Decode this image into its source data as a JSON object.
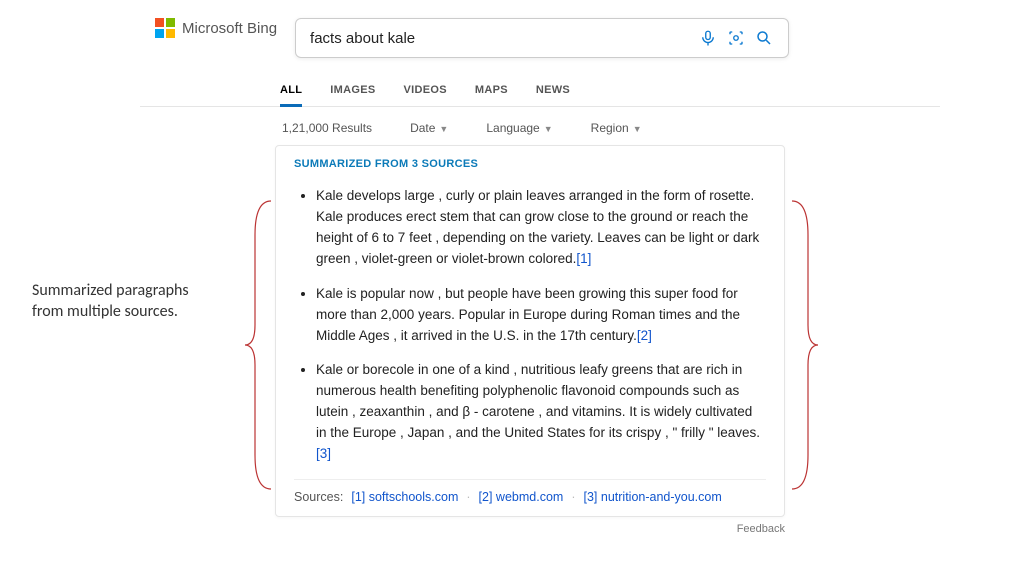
{
  "brand": "Microsoft Bing",
  "search": {
    "query": "facts about kale"
  },
  "tabs": [
    "ALL",
    "IMAGES",
    "VIDEOS",
    "MAPS",
    "NEWS"
  ],
  "results_count": "1,21,000 Results",
  "filters": {
    "date": "Date",
    "language": "Language",
    "region": "Region"
  },
  "summary": {
    "label": "SUMMARIZED FROM 3 SOURCES",
    "items": [
      {
        "text": "Kale develops large , curly or plain leaves arranged in the form of rosette. Kale produces erect stem that can grow close to the ground or reach the height of 6 to 7 feet , depending on the variety. Leaves can be light or dark green , violet-green or violet-brown colored.",
        "cite": "[1]"
      },
      {
        "text": "Kale is popular now , but people have been growing this super food for more than 2,000 years. Popular in Europe during Roman times and the Middle Ages , it arrived in the U.S. in the 17th century.",
        "cite": "[2]"
      },
      {
        "text": "Kale or borecole in one of a kind , nutritious leafy greens that are rich in numerous health benefiting polyphenolic flavonoid compounds such as lutein , zeaxanthin , and β - carotene , and vitamins. It is widely cultivated in the Europe , Japan , and the United States for its crispy , \" frilly \" leaves.",
        "cite": "[3]"
      }
    ],
    "sources_label": "Sources:",
    "sources": [
      {
        "n": "[1]",
        "domain": "softschools.com"
      },
      {
        "n": "[2]",
        "domain": "webmd.com"
      },
      {
        "n": "[3]",
        "domain": "nutrition-and-you.com"
      }
    ]
  },
  "feedback": "Feedback",
  "annotation": "Summarized paragraphs from multiple sources."
}
